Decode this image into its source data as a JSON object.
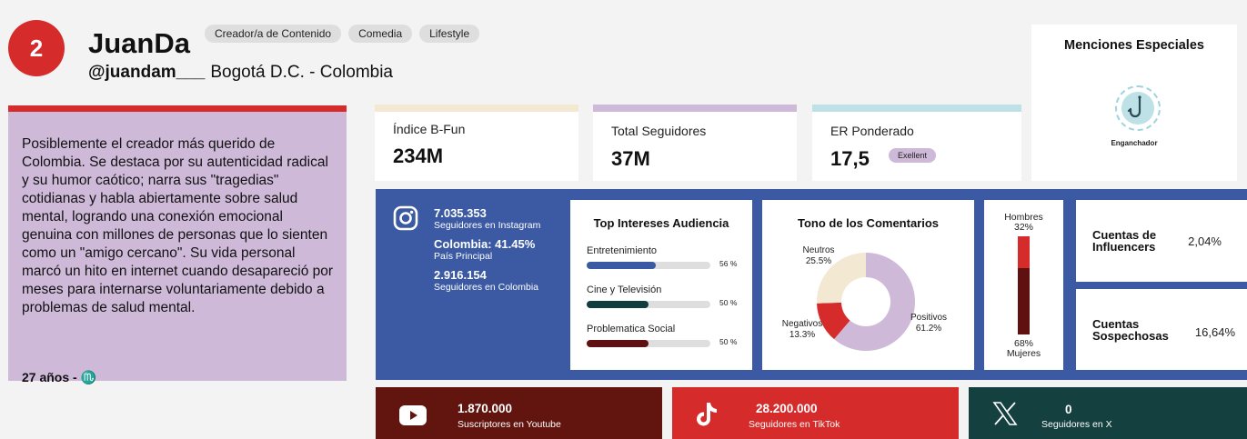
{
  "profile": {
    "rank": "2",
    "name": "JuanDa",
    "handle": "@juandam___",
    "location": "Bogotá D.C. - Colombia",
    "tags": [
      "Creador/a de Contenido",
      "Comedia",
      "Lifestyle"
    ],
    "bio": "Posiblemente el creador más querido de Colombia. Se destaca por su autenticidad radical y su humor caótico; narra sus \"tragedias\" cotidianas y habla abiertamente sobre salud mental, logrando una conexión emocional genuina con millones de personas que lo sienten como un \"amigo cercano\". Su vida personal marcó un hito en internet cuando desapareció por meses para internarse voluntariamente debido a problemas de salud mental.",
    "age": "27 años",
    "zodiac_symbol": "♏"
  },
  "metrics": {
    "bfun": {
      "label": "Índice B-Fun",
      "value": "234M",
      "color": "#f3e8d2"
    },
    "followers": {
      "label": "Total Seguidores",
      "value": "37M",
      "color": "#cfb9d9"
    },
    "er": {
      "label": "ER Ponderado",
      "value": "17,5",
      "badge": "Exellent",
      "color": "#bde1e6"
    }
  },
  "mentions": {
    "title": "Menciones Especiales",
    "items": [
      {
        "label": "Enganchador",
        "icon": "fishhook-icon"
      }
    ]
  },
  "instagram": {
    "followers": "7.035.353",
    "followers_label": "Seguidores en Instagram",
    "main_country": "Colombia: 41.45%",
    "main_country_label": "País Principal",
    "country_followers": "2.916.154",
    "country_followers_label": "Seguidores en Colombia"
  },
  "interests": {
    "title": "Top Intereses Audiencia",
    "items": [
      {
        "label": "Entretenimiento",
        "pct_text": "56 %",
        "pct": 56,
        "color": "#3b5aa3"
      },
      {
        "label": "Cine y Televisión",
        "pct_text": "50 %",
        "pct": 50,
        "color": "#123d3f"
      },
      {
        "label": "Problematica Social",
        "pct_text": "50 %",
        "pct": 50,
        "color": "#5f1010"
      }
    ]
  },
  "tone": {
    "title": "Tono de los Comentarios",
    "slices": [
      {
        "label": "Positivos",
        "pct_text": "61.2%",
        "value": 61.2,
        "color": "#cfb9d9"
      },
      {
        "label": "Negativos",
        "pct_text": "13.3%",
        "value": 13.3,
        "color": "#d62b2b"
      },
      {
        "label": "Neutros",
        "pct_text": "25.5%",
        "value": 25.5,
        "color": "#f3e8d2"
      }
    ]
  },
  "gender": {
    "men_label": "Hombres",
    "men_pct_text": "32%",
    "men": 32,
    "women_label": "Mujeres",
    "women_pct_text": "68%",
    "women": 68,
    "men_color": "#d62b2b",
    "women_color": "#5f1010"
  },
  "accounts": {
    "influencers_label": "Cuentas de Influencers",
    "influencers_value": "2,04%",
    "suspicious_label": "Cuentas Sospechosas",
    "suspicious_value": "16,64%"
  },
  "socials": {
    "youtube": {
      "value": "1.870.000",
      "label": "Suscriptores en Youtube",
      "color": "#62150f"
    },
    "tiktok": {
      "value": "28.200.000",
      "label": "Seguidores en TikTok",
      "color": "#d62b2b"
    },
    "x": {
      "value": "0",
      "label": "Seguidores en X",
      "color": "#14403f"
    }
  }
}
